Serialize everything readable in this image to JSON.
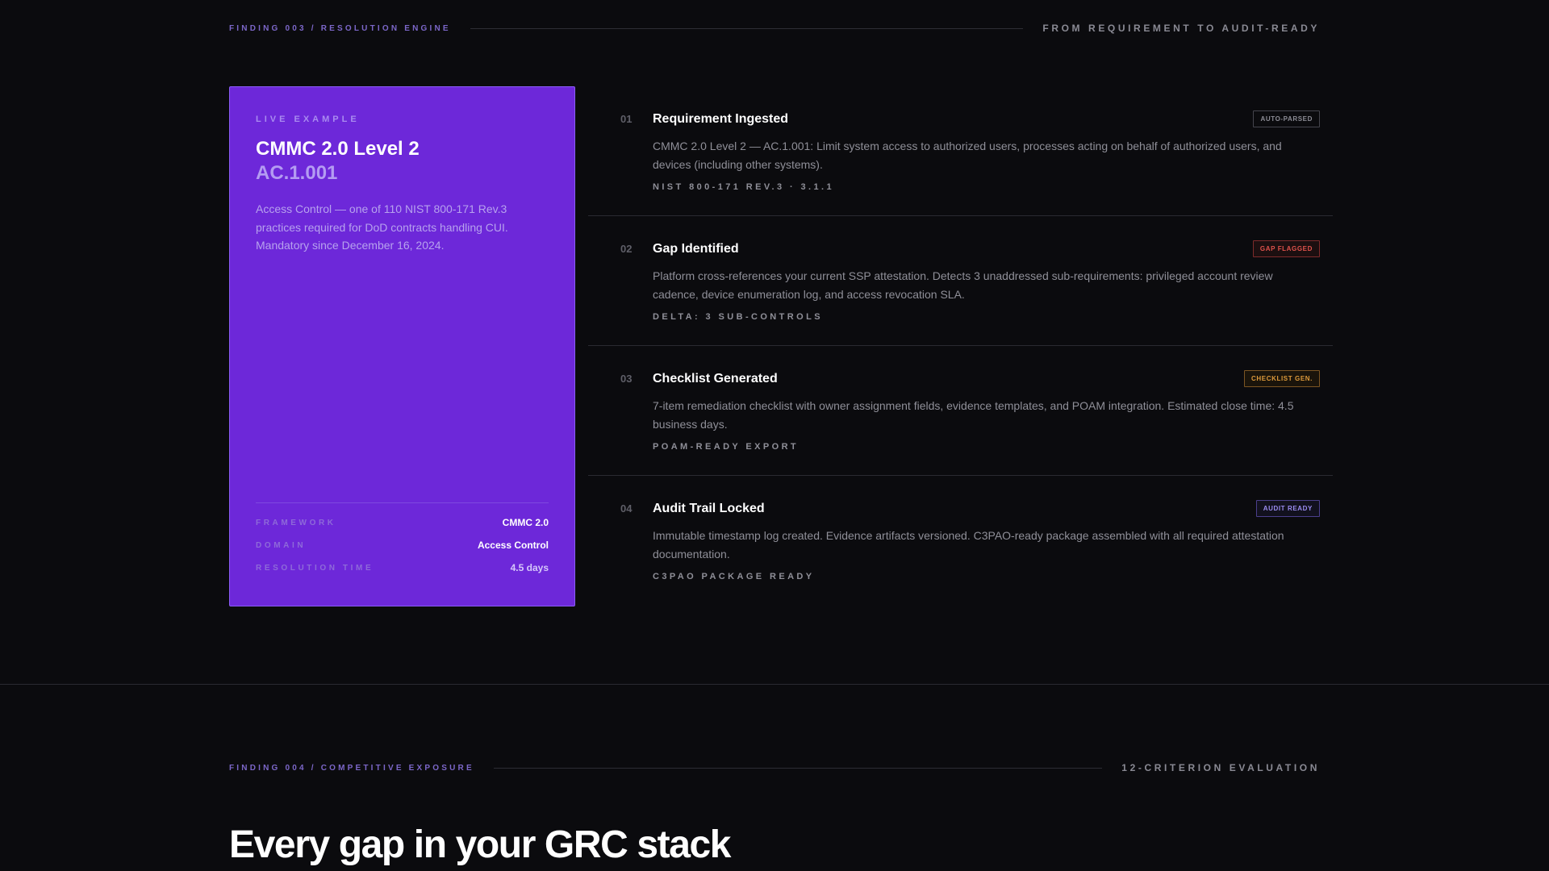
{
  "section1": {
    "label": "FINDING 003 / RESOLUTION ENGINE",
    "right_label": "FROM REQUIREMENT TO AUDIT-READY"
  },
  "card": {
    "eyebrow": "LIVE EXAMPLE",
    "title": "CMMC 2.0 Level 2",
    "subtitle": "AC.1.001",
    "description": "Access Control — one of 110 NIST 800-171 Rev.3 practices required for DoD contracts handling CUI. Mandatory since December 16, 2024.",
    "meta": [
      {
        "key": "FRAMEWORK",
        "value": "CMMC 2.0"
      },
      {
        "key": "DOMAIN",
        "value": "Access Control"
      },
      {
        "key": "RESOLUTION TIME",
        "value": "4.5 days"
      }
    ]
  },
  "steps": [
    {
      "num": "01",
      "title": "Requirement Ingested",
      "badge": "AUTO-PARSED",
      "body": "CMMC 2.0 Level 2 — AC.1.001: Limit system access to authorized users, processes acting on behalf of authorized users, and devices (including other systems).",
      "tag": "NIST 800-171 REV.3 · 3.1.1"
    },
    {
      "num": "02",
      "title": "Gap Identified",
      "badge": "GAP FLAGGED",
      "body": "Platform cross-references your current SSP attestation. Detects 3 unaddressed sub-requirements: privileged account review cadence, device enumeration log, and access revocation SLA.",
      "tag": "DELTA: 3 SUB-CONTROLS"
    },
    {
      "num": "03",
      "title": "Checklist Generated",
      "badge": "CHECKLIST GEN.",
      "body": "7-item remediation checklist with owner assignment fields, evidence templates, and POAM integration. Estimated close time: 4.5 business days.",
      "tag": "POAM-READY EXPORT"
    },
    {
      "num": "04",
      "title": "Audit Trail Locked",
      "badge": "AUDIT READY",
      "body": "Immutable timestamp log created. Evidence artifacts versioned. C3PAO-ready package assembled with all required attestation documentation.",
      "tag": "C3PAO PACKAGE READY"
    }
  ],
  "section2": {
    "label": "FINDING 004 / COMPETITIVE EXPOSURE",
    "right_label": "12-CRITERION EVALUATION",
    "headline": "Every gap in your GRC stack"
  },
  "colors": {
    "background": "#0b0b0e",
    "card": "#6d28d9",
    "accent": "#7c5cf2",
    "badge_red": "#e0524c",
    "badge_amber": "#dd9a3b",
    "badge_violet": "#9b8cf0"
  }
}
